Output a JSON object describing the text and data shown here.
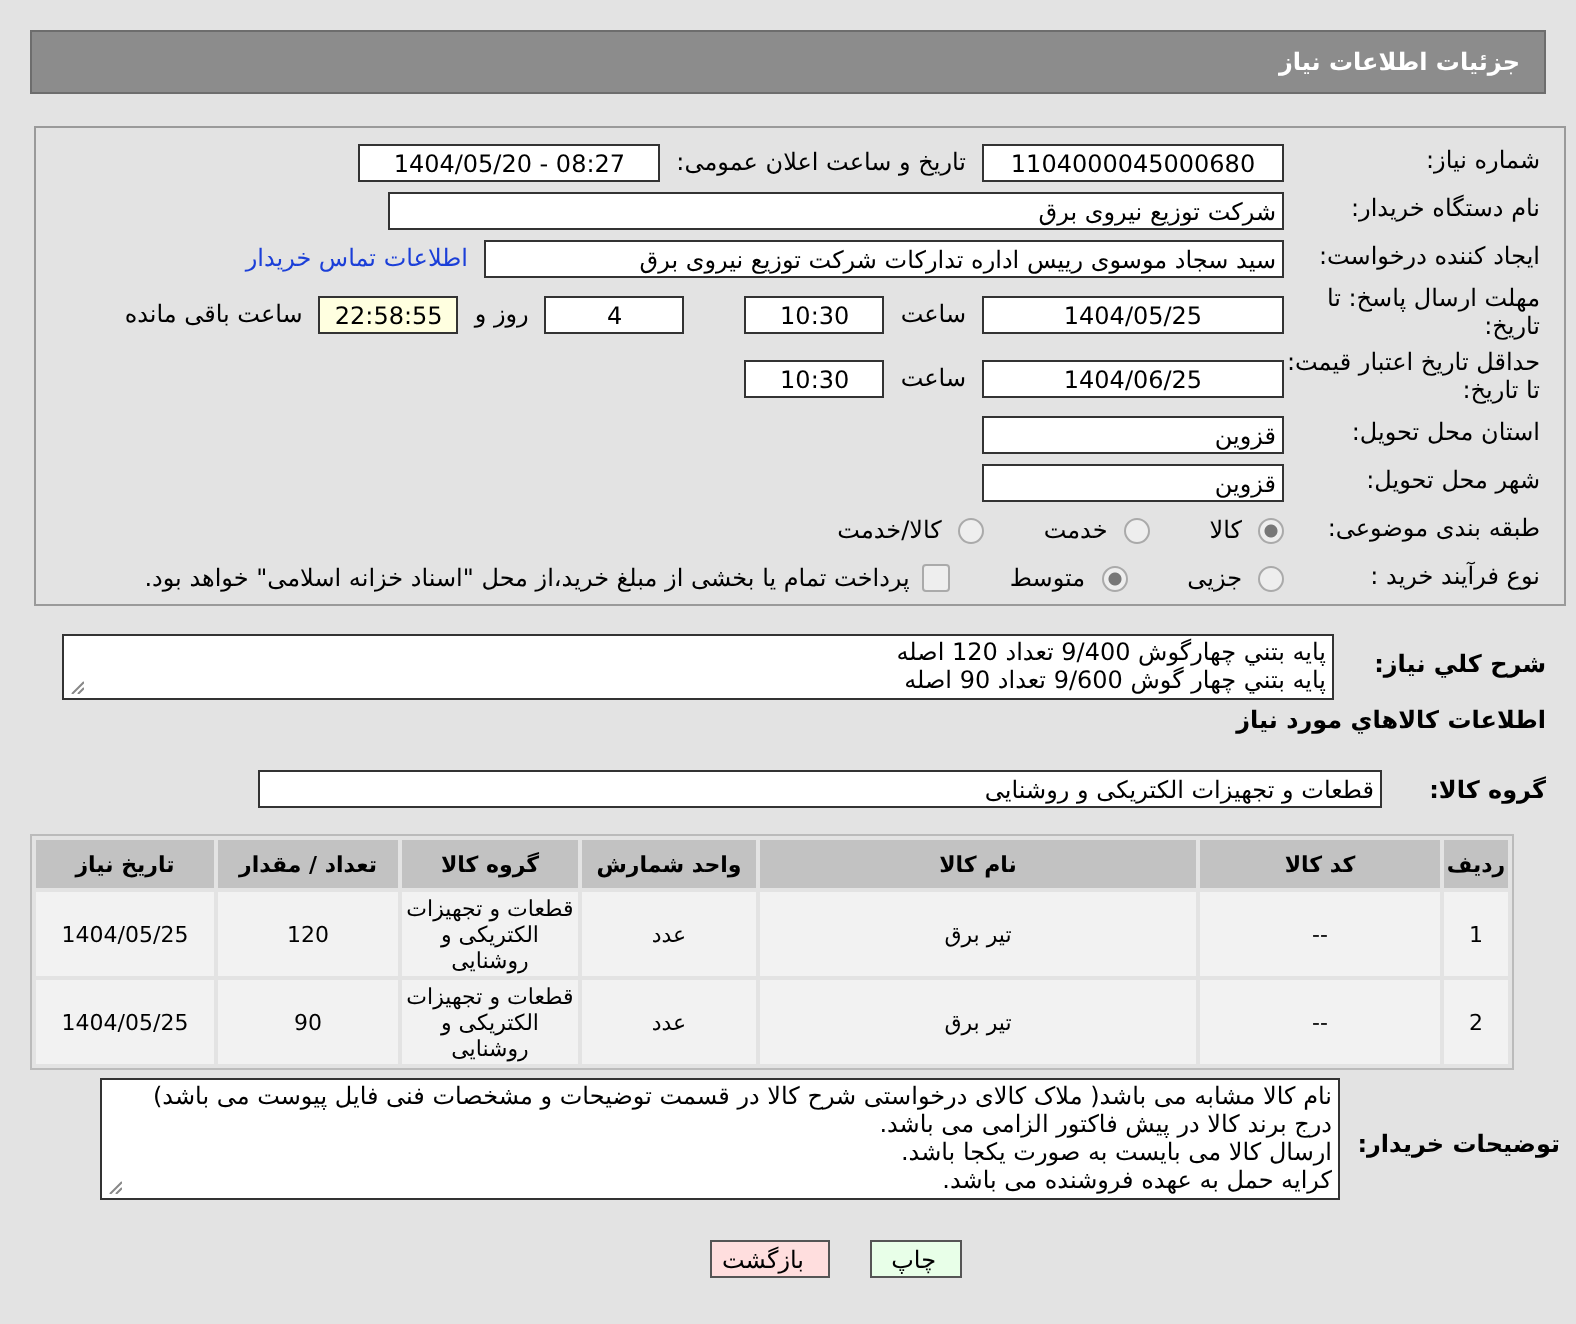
{
  "header": {
    "title": "جزئیات اطلاعات نیاز"
  },
  "form": {
    "need_number": {
      "label": "شماره نیاز:",
      "value": "1104000045000680"
    },
    "announce": {
      "label": "تاریخ و ساعت اعلان عمومی:",
      "value": "1404/05/20 - 08:27"
    },
    "buyer_org": {
      "label": "نام دستگاه خریدار:",
      "value": "شرکت توزیع نیروی برق"
    },
    "creator": {
      "label": "ایجاد کننده درخواست:",
      "value": "سید سجاد موسوی رییس اداره تدارکات شرکت توزیع نیروی برق",
      "link": "اطلاعات تماس خریدار"
    },
    "deadline": {
      "label": "مهلت ارسال پاسخ: تا تاریخ:",
      "date": "1404/05/25",
      "time_label": "ساعت",
      "time": "10:30",
      "days": "4",
      "days_label": "روز و",
      "remaining": "22:58:55",
      "remaining_label": "ساعت باقی مانده"
    },
    "validity": {
      "label": "حداقل تاریخ اعتبار قیمت: تا تاریخ:",
      "date": "1404/06/25",
      "time_label": "ساعت",
      "time": "10:30"
    },
    "province": {
      "label": "استان محل تحویل:",
      "value": "قزوین"
    },
    "city": {
      "label": "شهر محل تحویل:",
      "value": "قزوین"
    },
    "category": {
      "label": "طبقه بندی موضوعی:",
      "options": [
        {
          "label": "کالا",
          "selected": true
        },
        {
          "label": "خدمت",
          "selected": false
        },
        {
          "label": "کالا/خدمت",
          "selected": false
        }
      ]
    },
    "process": {
      "label": "نوع فرآیند خرید :",
      "options": [
        {
          "label": "جزیی",
          "selected": false
        },
        {
          "label": "متوسط",
          "selected": true
        }
      ],
      "payment": {
        "checked": false,
        "label": "پرداخت تمام یا بخشی از مبلغ خرید،از محل \"اسناد خزانه اسلامی\" خواهد بود."
      }
    }
  },
  "description": {
    "label": "شرح کلي نياز:",
    "lines": [
      "پايه بتني چهارگوش  9/400  تعداد 120 اصله",
      "پايه بتني چهار گوش 9/600 تعداد 90 اصله"
    ]
  },
  "items_heading": "اطلاعات كالاهاي مورد نياز",
  "goods_group": {
    "label": "گروه کالا:",
    "value": "قطعات و تجهیزات الکتریکی و روشنایی"
  },
  "table": {
    "columns": [
      "ردیف",
      "کد کالا",
      "نام کالا",
      "واحد شمارش",
      "گروه کالا",
      "تعداد / مقدار",
      "تاریخ نیاز"
    ],
    "rows": [
      [
        "1",
        "--",
        "تیر برق",
        "عدد",
        "قطعات و تجهیزات الکتریکی و روشنایی",
        "120",
        "1404/05/25"
      ],
      [
        "2",
        "--",
        "تیر برق",
        "عدد",
        "قطعات و تجهیزات الکتریکی و روشنایی",
        "90",
        "1404/05/25"
      ]
    ]
  },
  "buyer_notes": {
    "label": "توضیحات خریدار:",
    "lines": [
      "نام کالا مشابه می باشد( ملاک کالای درخواستی شرح کالا در قسمت توضیحات و مشخصات فنی فایل پیوست می باشد)",
      "درج برند کالا در پیش فاکتور الزامی می باشد.",
      "ارسال کالا می بایست به صورت یکجا باشد.",
      "کرایه حمل به عهده فروشنده می باشد."
    ]
  },
  "buttons": [
    {
      "label": "چاپ",
      "kind": "print"
    },
    {
      "label": "بازگشت",
      "kind": "back"
    }
  ]
}
